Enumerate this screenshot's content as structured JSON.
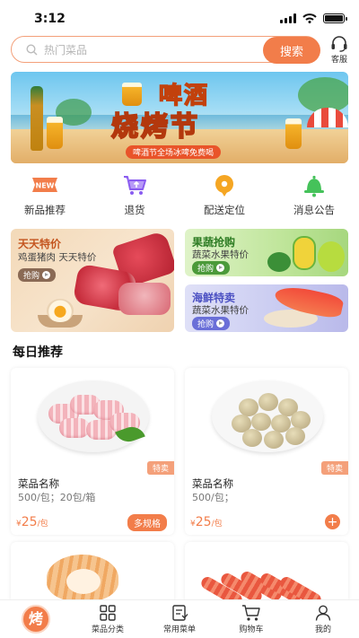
{
  "status_bar": {
    "time": "3:12"
  },
  "search": {
    "placeholder": "热门菜品",
    "button_label": "搜索"
  },
  "service": {
    "label": "客服",
    "icon": "headset-icon"
  },
  "banner": {
    "title_line1": "啤酒",
    "title_line2": "烧烤节",
    "subtitle": "啤酒节全场冰啤免费喝"
  },
  "categories": [
    {
      "label": "新品推荐",
      "icon": "new-badge-icon",
      "badge": "NEW"
    },
    {
      "label": "退货",
      "icon": "return-cart-icon"
    },
    {
      "label": "配送定位",
      "icon": "location-pin-icon"
    },
    {
      "label": "消息公告",
      "icon": "bell-icon"
    }
  ],
  "promos": {
    "daily": {
      "title": "天天特价",
      "subtitle": "鸡蛋猪肉 天天特价",
      "button": "抢购"
    },
    "fruit": {
      "title": "果蔬抢购",
      "subtitle": "蔬菜水果特价",
      "button": "抢购"
    },
    "seafood": {
      "title": "海鲜特卖",
      "subtitle": "蔬菜水果特价",
      "button": "抢购"
    }
  },
  "daily_recommend": {
    "title": "每日推荐",
    "items": [
      {
        "tag": "特卖",
        "name": "菜品名称",
        "spec": "500/包；20包/箱",
        "currency": "¥",
        "price": "25",
        "unit": "/包",
        "action": "多规格"
      },
      {
        "tag": "特卖",
        "name": "菜品名称",
        "spec": "500/包；",
        "currency": "¥",
        "price": "25",
        "unit": "/包",
        "action": "+"
      }
    ]
  },
  "tabbar": {
    "items": [
      {
        "label": "烤",
        "icon": "home-logo-icon"
      },
      {
        "label": "菜品分类",
        "icon": "grid-icon"
      },
      {
        "label": "常用菜单",
        "icon": "menu-list-icon"
      },
      {
        "label": "购物车",
        "icon": "cart-icon"
      },
      {
        "label": "我的",
        "icon": "user-icon"
      }
    ]
  },
  "colors": {
    "accent": "#f27d4a",
    "tag": "#f4a07a"
  }
}
